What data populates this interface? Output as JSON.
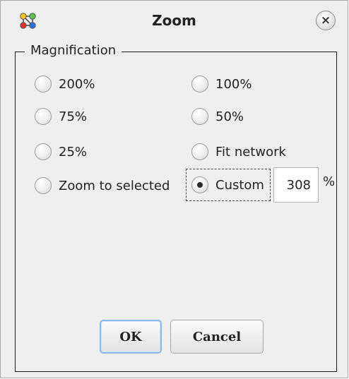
{
  "dialog": {
    "title": "Zoom",
    "app_icon": "network-graph-icon",
    "close_icon": "close-icon",
    "close_symbol": "×"
  },
  "magnification": {
    "legend": "Magnification",
    "options": [
      {
        "label": "200%",
        "selected": false
      },
      {
        "label": "100%",
        "selected": false
      },
      {
        "label": "75%",
        "selected": false
      },
      {
        "label": "50%",
        "selected": false
      },
      {
        "label": "25%",
        "selected": false
      },
      {
        "label": "Fit network",
        "selected": false
      },
      {
        "label": "Zoom to selected",
        "selected": false
      },
      {
        "label": "Custom",
        "selected": true
      }
    ],
    "custom_value": "308",
    "custom_unit": "%"
  },
  "buttons": {
    "ok_label": "OK",
    "cancel_label": "Cancel"
  }
}
